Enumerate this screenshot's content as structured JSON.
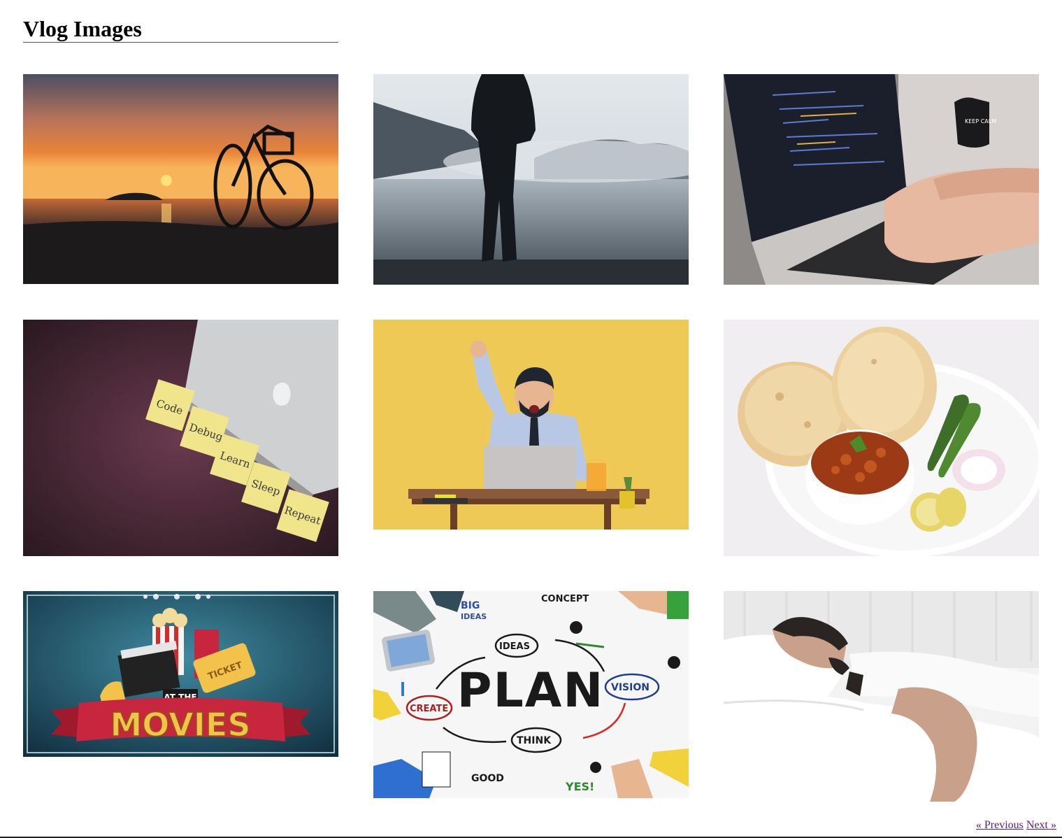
{
  "page": {
    "title": "Vlog Images"
  },
  "gallery": {
    "images": [
      {
        "subject": "bicycle-sunset-beach",
        "colors": [
          "#1c1a1b",
          "#e8833a",
          "#f7c46a",
          "#4b4e63"
        ]
      },
      {
        "subject": "man-standing-misty-lake",
        "colors": [
          "#d6dde2",
          "#7d8b96",
          "#1c1f24",
          "#3c4650"
        ]
      },
      {
        "subject": "hands-typing-laptop-code",
        "colors": [
          "#1b1f2c",
          "#c9c6c3",
          "#e7b9a1",
          "#2a2f46"
        ]
      },
      {
        "subject": "laptop-sticky-notes",
        "colors": [
          "#3a1f2c",
          "#f0e58a",
          "#cfd0d2",
          "#5a3040"
        ]
      },
      {
        "subject": "excited-man-at-laptop",
        "colors": [
          "#f2cd5b",
          "#b8c7e3",
          "#8a5a3a",
          "#1f2630"
        ]
      },
      {
        "subject": "chole-bhature-plate",
        "colors": [
          "#f4f1f0",
          "#e9c994",
          "#9c3a16",
          "#f7f7f7"
        ]
      },
      {
        "subject": "at-the-movies-banner",
        "colors": [
          "#1f5e73",
          "#c8253e",
          "#f3c24b",
          "#0f2a3a"
        ]
      },
      {
        "subject": "plan-concept-sketch",
        "colors": [
          "#f6f6f6",
          "#1a1a1a",
          "#4d9fe0",
          "#d7281f"
        ]
      },
      {
        "subject": "man-sleeping-bed",
        "colors": [
          "#f3f3f3",
          "#ffffff",
          "#2a2422",
          "#c9a089"
        ]
      }
    ],
    "sticky_notes": [
      "Code",
      "Debug",
      "Learn",
      "Sleep",
      "Repeat"
    ],
    "movies_small": "AT THE",
    "movies_big": "MOVIES",
    "movies_ticket": "TICKET",
    "plan_words": {
      "center": "PLAN",
      "big_ideas_1": "BIG",
      "big_ideas_2": "IDEAS",
      "concept": "CONCEPT",
      "ideas": "IDEAS",
      "vision": "VISION",
      "create": "CREATE",
      "think": "THINK",
      "good": "GOOD",
      "yes": "YES!"
    },
    "mug_text": "KEEP CALM"
  },
  "pagination": {
    "previous": "« Previous",
    "next": "Next »"
  }
}
